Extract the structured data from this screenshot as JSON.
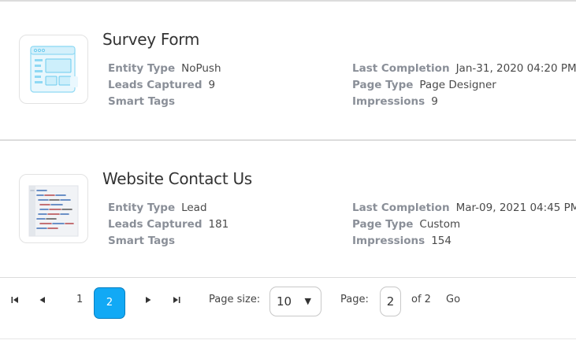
{
  "cards": [
    {
      "title": "Survey Form",
      "thumbnail_icon": "form-layout-icon",
      "left": [
        {
          "label": "Entity Type",
          "value": "NoPush"
        },
        {
          "label": "Leads Captured",
          "value": "9"
        },
        {
          "label": "Smart Tags",
          "value": ""
        }
      ],
      "right": [
        {
          "label": "Last Completion",
          "value": "Jan-31, 2020 04:20 PM"
        },
        {
          "label": "Page Type",
          "value": "Page Designer"
        },
        {
          "label": "Impressions",
          "value": "9"
        }
      ]
    },
    {
      "title": "Website Contact Us",
      "thumbnail_icon": "code-screenshot-icon",
      "left": [
        {
          "label": "Entity Type",
          "value": "Lead"
        },
        {
          "label": "Leads Captured",
          "value": "181"
        },
        {
          "label": "Smart Tags",
          "value": ""
        }
      ],
      "right": [
        {
          "label": "Last Completion",
          "value": "Mar-09, 2021 04:45 PM"
        },
        {
          "label": "Page Type",
          "value": "Custom"
        },
        {
          "label": "Impressions",
          "value": "154"
        }
      ]
    }
  ],
  "pager": {
    "first_icon": "⏮",
    "prev_icon": "◀",
    "next_icon": "▶",
    "last_icon": "⏭",
    "pages": [
      "1"
    ],
    "current_page": "2",
    "page_size_label": "Page size:",
    "page_size_value": "10",
    "page_label": "Page:",
    "page_value": "2",
    "of_text": "of 2",
    "go_label": "Go"
  },
  "colors": {
    "accent": "#12a9f5",
    "label": "#8a8f98"
  }
}
